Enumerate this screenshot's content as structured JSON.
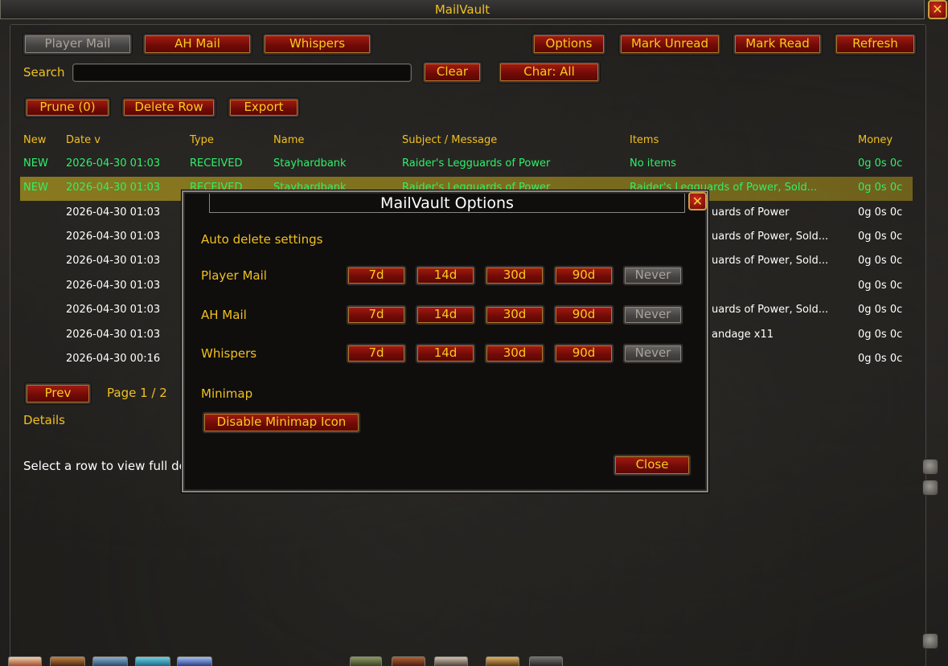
{
  "window": {
    "title": "MailVault"
  },
  "tabs": {
    "player_mail": "Player Mail",
    "ah_mail": "AH Mail",
    "whispers": "Whispers"
  },
  "toolbar": {
    "options": "Options",
    "mark_unread": "Mark Unread",
    "mark_read": "Mark Read",
    "refresh": "Refresh",
    "search_label": "Search",
    "search_value": "",
    "clear": "Clear",
    "char_filter": "Char: All",
    "prune": "Prune (0)",
    "delete_row": "Delete Row",
    "export": "Export"
  },
  "table": {
    "headers": [
      "New",
      "Date v",
      "Type",
      "Name",
      "Subject / Message",
      "Items",
      "Money"
    ],
    "rows": [
      {
        "new": "NEW",
        "date": "2026-04-30 01:03",
        "type": "RECEIVED",
        "name": "Stayhardbank",
        "subject": "Raider's Legguards of Power",
        "items": "No items",
        "money": "0g 0s 0c"
      },
      {
        "new": "NEW",
        "date": "2026-04-30 01:03",
        "type": "RECEIVED",
        "name": "Stayhardbank",
        "subject": "Raider's Legguards of Power",
        "items": "Raider's Legguards of Power, Sold...",
        "money": "0g 0s 0c"
      },
      {
        "new": "",
        "date": "2026-04-30 01:03",
        "type": "",
        "name": "",
        "subject": "",
        "items": "uards of Power",
        "money": "0g 0s 0c"
      },
      {
        "new": "",
        "date": "2026-04-30 01:03",
        "type": "",
        "name": "",
        "subject": "",
        "items": "uards of Power, Sold...",
        "money": "0g 0s 0c"
      },
      {
        "new": "",
        "date": "2026-04-30 01:03",
        "type": "",
        "name": "",
        "subject": "",
        "items": "uards of Power, Sold...",
        "money": "0g 0s 0c"
      },
      {
        "new": "",
        "date": "2026-04-30 01:03",
        "type": "",
        "name": "",
        "subject": "",
        "items": "",
        "money": "0g 0s 0c"
      },
      {
        "new": "",
        "date": "2026-04-30 01:03",
        "type": "",
        "name": "",
        "subject": "",
        "items": "uards of Power, Sold...",
        "money": "0g 0s 0c"
      },
      {
        "new": "",
        "date": "2026-04-30 01:03",
        "type": "",
        "name": "",
        "subject": "",
        "items": "andage x11",
        "money": "0g 0s 0c"
      },
      {
        "new": "",
        "date": "2026-04-30 00:16",
        "type": "",
        "name": "",
        "subject": "",
        "items": "",
        "money": "0g 0s 0c"
      }
    ]
  },
  "pager": {
    "prev": "Prev",
    "page": "Page 1 / 2"
  },
  "details": {
    "label": "Details",
    "text": "Select a row to view full de"
  },
  "options_dialog": {
    "title": "MailVault Options",
    "auto_delete_heading": "Auto delete settings",
    "rows": [
      {
        "label": "Player Mail"
      },
      {
        "label": "AH Mail"
      },
      {
        "label": "Whispers"
      }
    ],
    "durations": [
      "7d",
      "14d",
      "30d",
      "90d",
      "Never"
    ],
    "minimap_heading": "Minimap",
    "minimap_button": "Disable Minimap Icon",
    "close": "Close"
  },
  "colors": {
    "gold_text": "#f0c020",
    "green_text": "#2ef06a",
    "button_red": "#8b1008",
    "selected_row": "#a8962a"
  }
}
